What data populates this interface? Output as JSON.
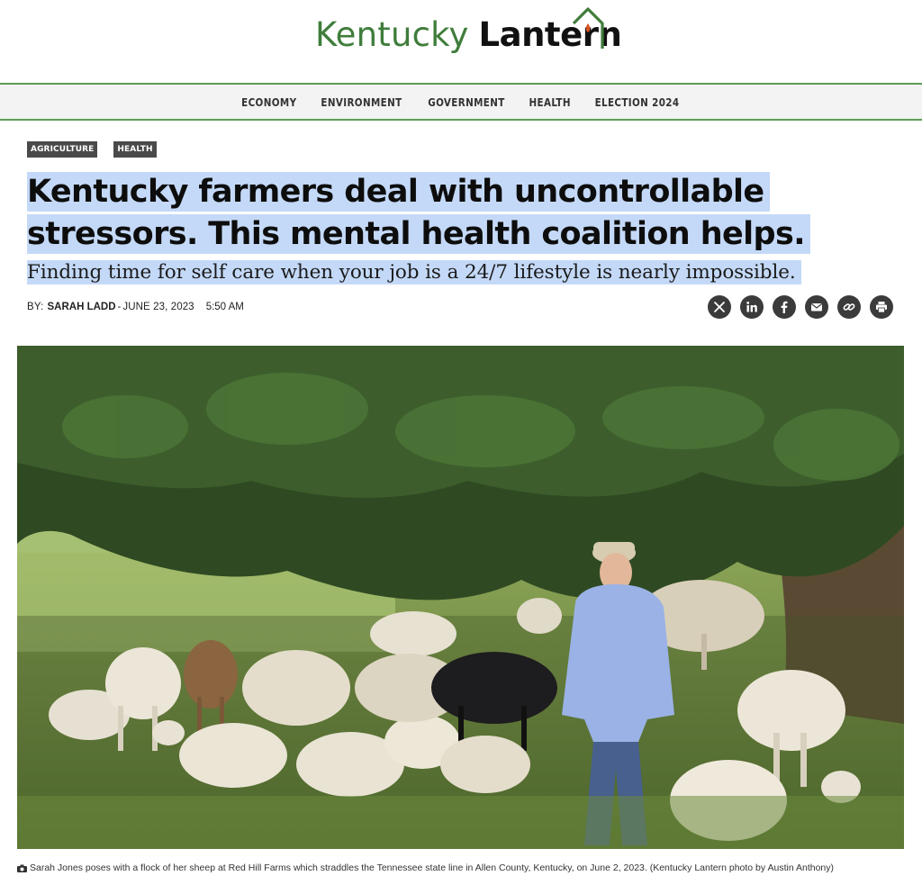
{
  "site": {
    "name_part1": "Kentucky",
    "name_part2": "Lantern",
    "brand_green": "#3f7d3b"
  },
  "nav": {
    "items": [
      "ECONOMY",
      "ENVIRONMENT",
      "GOVERNMENT",
      "HEALTH",
      "ELECTION 2024"
    ]
  },
  "article": {
    "tags": [
      "AGRICULTURE",
      "HEALTH"
    ],
    "headline_line1": "Kentucky farmers deal with uncontrollable",
    "headline_line2": "stressors. This mental health coalition helps.",
    "dek": "Finding time for self care when your job is a 24/7 lifestyle is nearly impossible.",
    "byline": {
      "by_label": "BY:",
      "author": "SARAH LADD",
      "separator": "-",
      "date": "JUNE 23, 2023",
      "time": "5:50 AM"
    },
    "share_icons": [
      "x-icon",
      "linkedin-icon",
      "facebook-icon",
      "email-icon",
      "link-icon",
      "print-icon"
    ],
    "photo_caption": "Sarah Jones poses with a flock of her sheep at Red Hill Farms which straddles the Tennessee state line in Allen County, Kentucky, on June 2, 2023. (Kentucky Lantern photo by Austin Anthony)",
    "highlight_color": "#c4d9f7"
  }
}
